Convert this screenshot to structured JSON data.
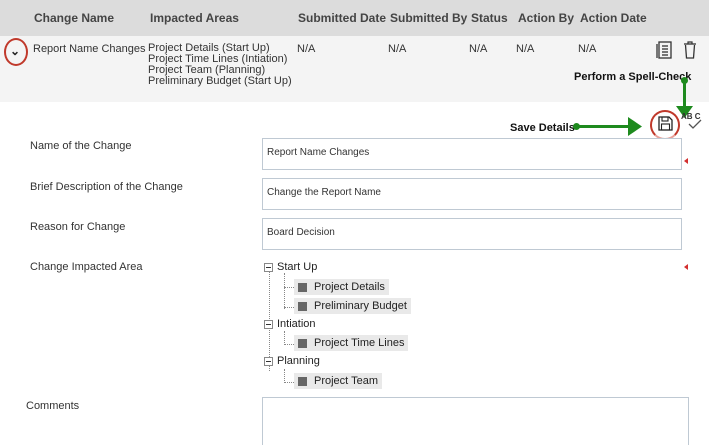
{
  "table": {
    "headers": [
      "Change Name",
      "Impacted Areas",
      "Submitted Date",
      "Submitted By",
      "Status",
      "Action By",
      "Action Date"
    ],
    "row": {
      "change_name": "Report Name Changes",
      "impacted_areas": [
        "Project Details (Start Up)",
        "Project Time Lines (Intiation)",
        "Project Team (Planning)",
        "Preliminary Budget (Start Up)"
      ],
      "submitted_date": "N/A",
      "submitted_by": "N/A",
      "status": "N/A",
      "action_by": "N/A",
      "action_date": "N/A"
    }
  },
  "annotations": {
    "spell_check": "Perform a Spell-Check",
    "save_details": "Save Details"
  },
  "spellcheck_icon_text": "AB C",
  "form": {
    "name_label": "Name of the Change",
    "name_value": "Report Name Changes",
    "description_label": "Brief Description of the Change",
    "description_value": "Change the Report Name",
    "reason_label": "Reason for Change",
    "reason_value": "Board Decision",
    "impacted_label": "Change Impacted Area",
    "comments_label": "Comments"
  },
  "tree": [
    {
      "label": "Start Up",
      "children": [
        "Project Details",
        "Preliminary Budget"
      ]
    },
    {
      "label": "Intiation",
      "children": [
        "Project Time Lines"
      ]
    },
    {
      "label": "Planning",
      "children": [
        "Project Team"
      ]
    }
  ],
  "colors": {
    "header_bg": "#dcdcdc",
    "annotation_green": "#1e8a1e",
    "highlight_red": "#c0392b"
  }
}
